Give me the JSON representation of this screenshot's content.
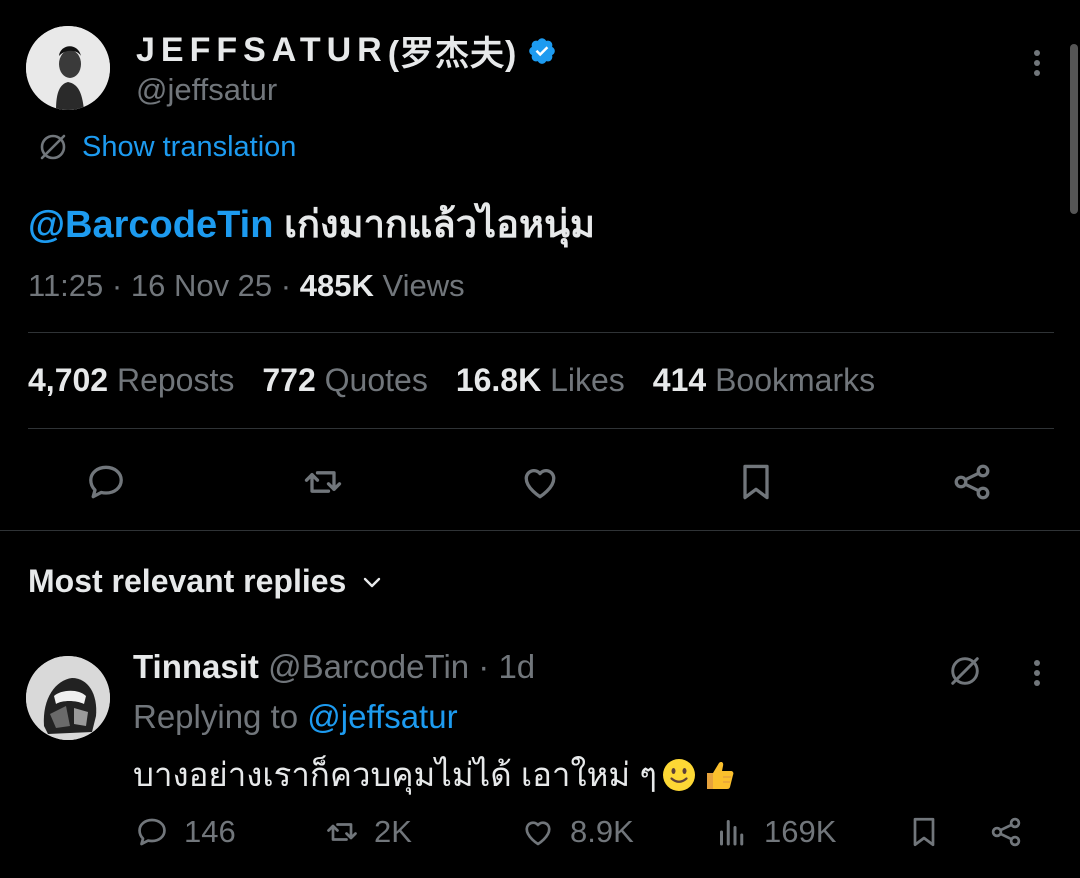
{
  "author": {
    "display_name": "JEFFSATUR",
    "display_name_cn": "(罗杰夫)",
    "handle": "@jeffsatur",
    "verified": true
  },
  "tweet": {
    "translate_label": "Show translation",
    "mention": "@BarcodeTin",
    "text": " เก่งมากแล้วไอหนุ่ม",
    "time": "11:25",
    "date": "16 Nov 25",
    "views_count": "485K",
    "views_label": "Views",
    "separator": " · "
  },
  "stats": [
    {
      "count": "4,702",
      "label": "Reposts"
    },
    {
      "count": "772",
      "label": "Quotes"
    },
    {
      "count": "16.8K",
      "label": "Likes"
    },
    {
      "count": "414",
      "label": "Bookmarks"
    }
  ],
  "actions": [
    "reply-icon",
    "repost-icon",
    "like-icon",
    "bookmark-icon",
    "share-icon"
  ],
  "replies_section": {
    "title": "Most relevant replies"
  },
  "reply": {
    "name": "Tinnasit",
    "handle": "@BarcodeTin",
    "age": "1d",
    "replying_label": "Replying to ",
    "replying_handle": "@jeffsatur",
    "text": "บางอย่างเราก็ควบคุมไม่ได้ เอาใหม่ ๆ",
    "emojis": [
      "slightly-smiling-face",
      "thumbs-up"
    ],
    "stats": {
      "replies": "146",
      "reposts": "2K",
      "likes": "8.9K",
      "views": "169K"
    }
  },
  "colors": {
    "background": "#000000",
    "text": "#e7e9ea",
    "muted": "#71767b",
    "accent": "#1d9bf0",
    "divider": "#2f3336"
  }
}
